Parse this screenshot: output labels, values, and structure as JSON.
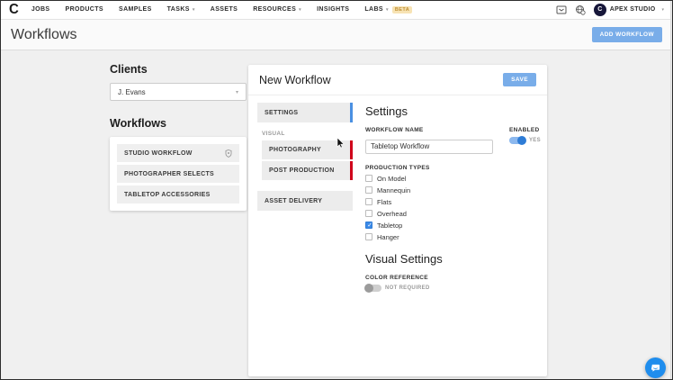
{
  "colors": {
    "accent_button": "#79ade9",
    "active_tab_bar": "#4a90e2",
    "alert_tab_bar": "#d0021b",
    "toggle_on_knob": "#2e7cd6",
    "checkbox_checked": "#3c8ae8",
    "chat_button": "#1f8ded",
    "labs_badge_bg": "#f7e3b4",
    "labs_badge_text": "#bf8f33"
  },
  "nav": {
    "logo_glyph": "C",
    "items": [
      {
        "label": "JOBS"
      },
      {
        "label": "PRODUCTS"
      },
      {
        "label": "SAMPLES"
      },
      {
        "label": "TASKS",
        "chevron": true
      },
      {
        "label": "ASSETS"
      },
      {
        "label": "RESOURCES",
        "chevron": true
      },
      {
        "label": "INSIGHTS"
      },
      {
        "label": "LABS",
        "chevron": true,
        "badge": "BETA"
      }
    ],
    "account": {
      "name": "APEX STUDIO",
      "avatar_glyph": "C"
    }
  },
  "header": {
    "title": "Workflows",
    "add_workflow_label": "ADD WORKFLOW"
  },
  "sidebar": {
    "clients_heading": "Clients",
    "client_select_value": "J. Evans",
    "workflows_heading": "Workflows",
    "workflows": [
      {
        "label": "STUDIO WORKFLOW",
        "locked": true
      },
      {
        "label": "PHOTOGRAPHER SELECTS",
        "locked": false
      },
      {
        "label": "TABLETOP ACCESSORIES",
        "locked": false
      }
    ]
  },
  "workflow_panel": {
    "title": "New Workflow",
    "save_label": "SAVE",
    "tabs": {
      "settings": "SETTINGS",
      "visual_group": "VISUAL",
      "photography": "PHOTOGRAPHY",
      "post_production": "POST PRODUCTION",
      "asset_delivery": "ASSET DELIVERY"
    },
    "settings": {
      "heading": "Settings",
      "workflow_name_label": "WORKFLOW NAME",
      "workflow_name_value": "Tabletop Workflow",
      "enabled_label": "ENABLED",
      "enabled_state": "YES",
      "production_types_label": "PRODUCTION TYPES",
      "production_types": [
        {
          "label": "On Model",
          "checked": false
        },
        {
          "label": "Mannequin",
          "checked": false
        },
        {
          "label": "Flats",
          "checked": false
        },
        {
          "label": "Overhead",
          "checked": false
        },
        {
          "label": "Tabletop",
          "checked": true
        },
        {
          "label": "Hanger",
          "checked": false
        }
      ],
      "visual_settings_heading": "Visual Settings",
      "color_reference_label": "COLOR REFERENCE",
      "color_reference_state": "NOT REQUIRED"
    }
  }
}
